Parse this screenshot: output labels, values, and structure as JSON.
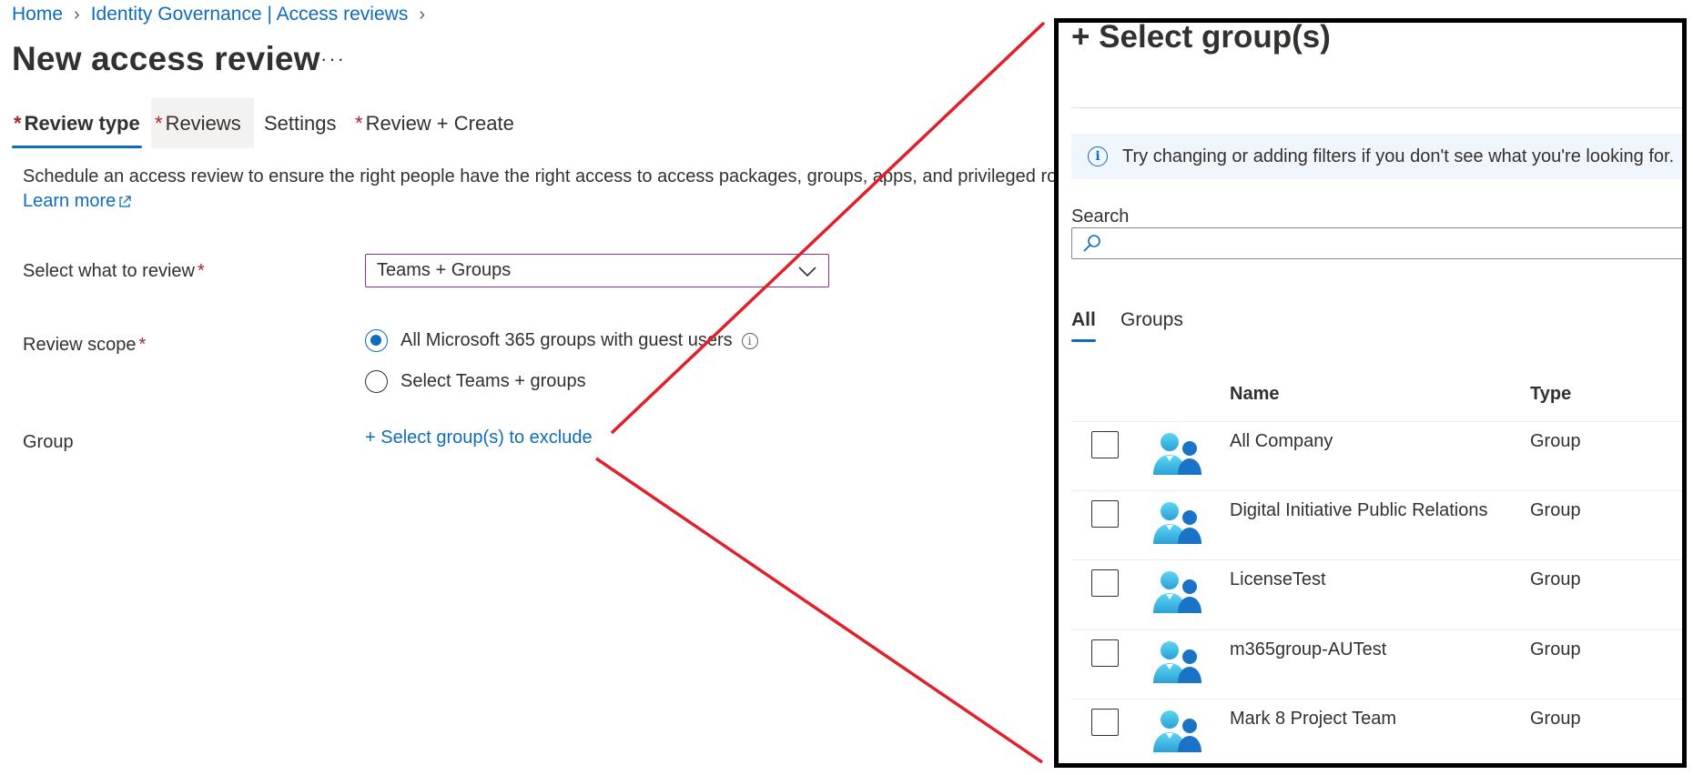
{
  "breadcrumb": {
    "items": [
      "Home",
      "Identity Governance | Access reviews"
    ]
  },
  "page": {
    "title": "New access review",
    "more": "···"
  },
  "tabs": [
    {
      "label": "Review type",
      "required": "*"
    },
    {
      "label": "Reviews",
      "required": "*"
    },
    {
      "label": "Settings",
      "required": ""
    },
    {
      "label": "Review + Create",
      "required": "*"
    }
  ],
  "description": {
    "text": "Schedule an access review to ensure the right people have the right access to access packages, groups, apps, and privileged roles.",
    "learn_more": "Learn more"
  },
  "form": {
    "select_label": "Select what to review",
    "select_value": "Teams + Groups",
    "scope_label": "Review scope",
    "scope_options": [
      "All Microsoft 365 groups with guest users",
      "Select Teams + groups"
    ],
    "scope_selected": 0,
    "group_label": "Group",
    "group_link": "+ Select group(s) to exclude",
    "required_mark": "*"
  },
  "panel": {
    "title": "+ Select group(s)",
    "info": "Try changing or adding filters if you don't see what you're looking for.",
    "search_label": "Search",
    "search_value": "",
    "tabs": [
      "All",
      "Groups"
    ],
    "columns": {
      "name": "Name",
      "type": "Type"
    },
    "rows": [
      {
        "name": "All Company",
        "type": "Group"
      },
      {
        "name": "Digital Initiative Public Relations",
        "type": "Group"
      },
      {
        "name": "LicenseTest",
        "type": "Group"
      },
      {
        "name": "m365group-AUTest",
        "type": "Group"
      },
      {
        "name": "Mark 8 Project Team",
        "type": "Group"
      }
    ]
  },
  "colors": {
    "accent": "#0f6cbd",
    "required": "#a4262c",
    "dropdown_border": "#8a2d9a",
    "annotation_line": "#e0202a"
  },
  "icons": [
    "chevron-right-icon",
    "more-icon",
    "external-link-icon",
    "chevron-down-icon",
    "info-icon",
    "search-icon",
    "group-icon"
  ]
}
